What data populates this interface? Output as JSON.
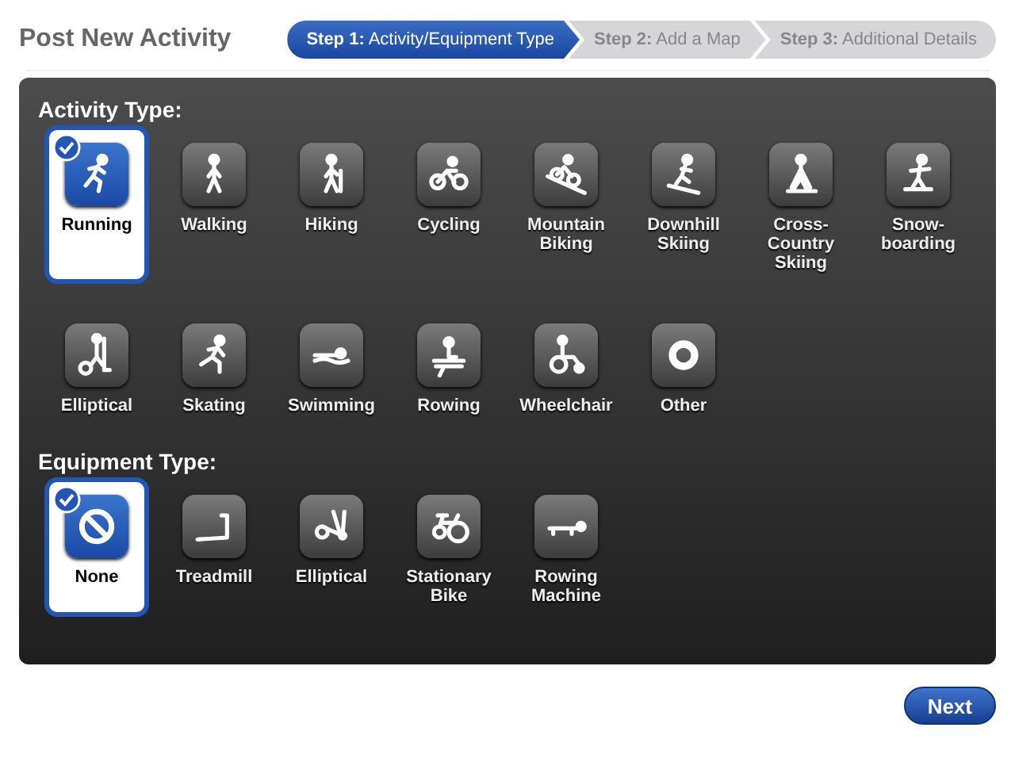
{
  "title": "Post New Activity",
  "steps": [
    {
      "label": "**Step 1:** Activity/Equipment Type",
      "selected": true
    },
    {
      "label": "**Step 2:** Add a Map",
      "selected": false
    },
    {
      "label": "**Step 3:** Additional Details",
      "selected": false
    }
  ],
  "sections": [
    {
      "heading": "Activity Type:",
      "options": [
        {
          "label": "Running",
          "selected": true
        },
        {
          "label": "Walking",
          "selected": false
        },
        {
          "label": "Hiking",
          "selected": false
        },
        {
          "label": "Cycling",
          "selected": false
        },
        {
          "label": "Mountain Biking",
          "selected": false
        },
        {
          "label": "Downhill Skiing",
          "selected": false
        },
        {
          "label": "Cross-Country Skiing",
          "selected": false
        },
        {
          "label": "Snow-boarding",
          "selected": false
        },
        {
          "label": "Elliptical",
          "selected": false
        },
        {
          "label": "Skating",
          "selected": false
        },
        {
          "label": "Swimming",
          "selected": false
        },
        {
          "label": "Rowing",
          "selected": false
        },
        {
          "label": "Wheelchair",
          "selected": false
        },
        {
          "label": "Other",
          "selected": false
        }
      ]
    },
    {
      "heading": "Equipment Type:",
      "options": [
        {
          "label": "None",
          "selected": true
        },
        {
          "label": "Treadmill",
          "selected": false
        },
        {
          "label": "Elliptical",
          "selected": false
        },
        {
          "label": "Stationary Bike",
          "selected": false
        },
        {
          "label": "Rowing Machine",
          "selected": false
        }
      ]
    }
  ],
  "next_button": "Next"
}
